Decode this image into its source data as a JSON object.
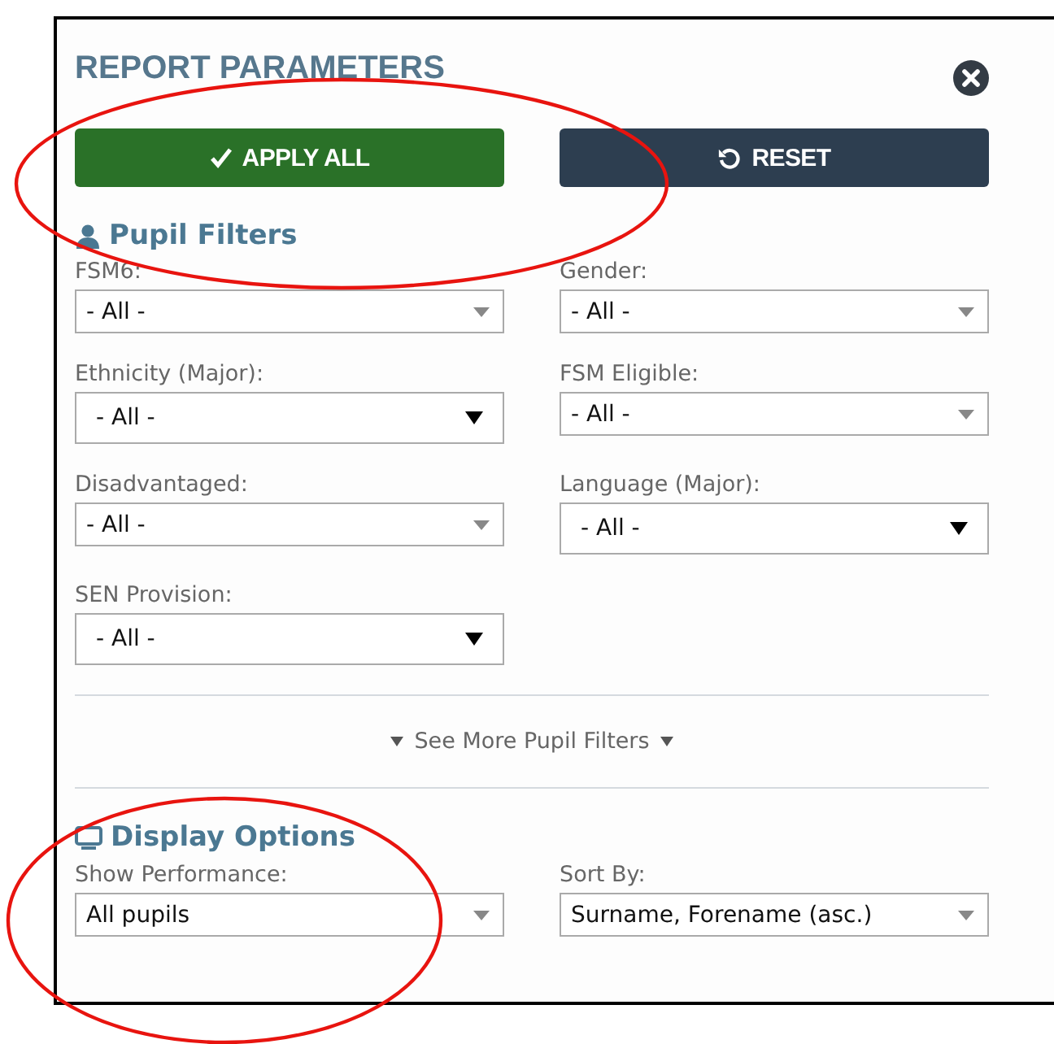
{
  "panel": {
    "title": "REPORT PARAMETERS"
  },
  "buttons": [
    {
      "kind": "apply",
      "label": "APPLY ALL"
    },
    {
      "kind": "reset",
      "label": "RESET"
    }
  ],
  "pupil_filters": {
    "heading": "Pupil Filters",
    "fields": [
      {
        "label": "FSM6:",
        "value": "- All -",
        "kind": "styled"
      },
      {
        "label": "Gender:",
        "value": "- All -",
        "kind": "styled"
      },
      {
        "label": "Ethnicity (Major):",
        "value": "- All -",
        "kind": "native"
      },
      {
        "label": "FSM Eligible:",
        "value": "- All -",
        "kind": "styled"
      },
      {
        "label": "Disadvantaged:",
        "value": "- All -",
        "kind": "styled"
      },
      {
        "label": "Language (Major):",
        "value": "- All -",
        "kind": "native"
      },
      {
        "label": "SEN Provision:",
        "value": "- All -",
        "kind": "native"
      }
    ],
    "more_link": "See More Pupil Filters"
  },
  "display_options": {
    "heading": "Display Options",
    "fields": [
      {
        "label": "Show Performance:",
        "value": "All pupils",
        "kind": "styled"
      },
      {
        "label": "Sort By:",
        "value": "Surname, Forename (asc.)",
        "kind": "styled"
      }
    ]
  },
  "annotations": [
    {
      "kind": "ellipse"
    },
    {
      "kind": "ellipse"
    }
  ]
}
